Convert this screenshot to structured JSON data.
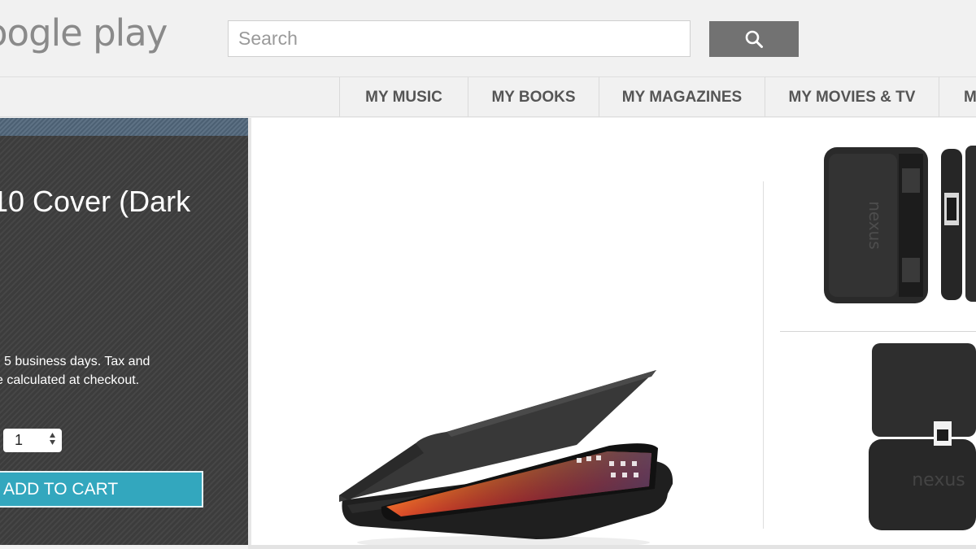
{
  "header": {
    "logo_text": "oogle play",
    "search": {
      "placeholder": "Search",
      "value": ""
    },
    "search_icon": "search-icon"
  },
  "nav": {
    "tabs": [
      {
        "label": "MY MUSIC"
      },
      {
        "label": "MY BOOKS"
      },
      {
        "label": "MY MAGAZINES"
      },
      {
        "label": "MY MOVIES & TV"
      },
      {
        "label": "M"
      }
    ]
  },
  "product": {
    "title": "10 Cover (Dark",
    "shipping_line_1": "5 business days. Tax and",
    "shipping_line_2": "e calculated at checkout.",
    "quantity": "1",
    "add_to_cart_label": "ADD TO CART"
  },
  "colors": {
    "accent": "#33a7be",
    "panel": "#404040",
    "strip": "#56697c",
    "search_button": "#727272"
  }
}
